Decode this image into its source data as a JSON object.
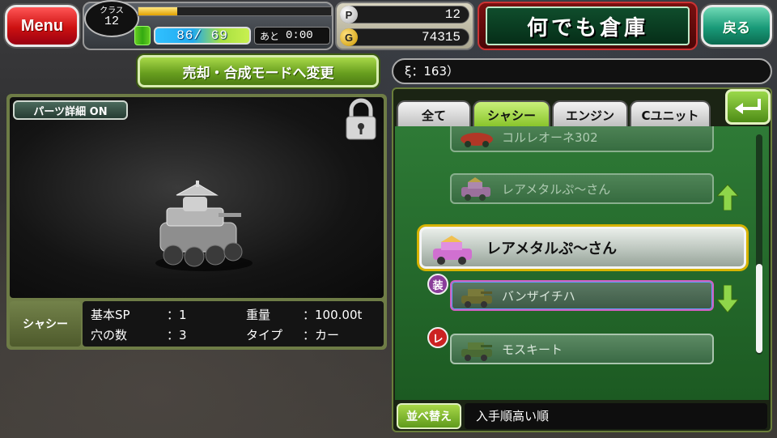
{
  "header": {
    "menu_label": "Menu",
    "class_label": "クラス",
    "class_level": "12",
    "xp_progress": 0.2,
    "stamina": "86/ 69",
    "timer_label": "あと",
    "timer_value": "0:00",
    "p_icon": "P",
    "p_value": "12",
    "g_icon": "G",
    "g_value": "74315",
    "title": "何でも倉庫",
    "back_label": "戻る"
  },
  "mode_button": "売却・合成モードへ変更",
  "item_count_text": "ξ：163）",
  "detail": {
    "parts_detail_toggle": "パーツ詳細 ON",
    "part_type": "シャシー",
    "stats": [
      {
        "label": "基本SP",
        "value": "：1"
      },
      {
        "label": "重量",
        "value": "：100.00t"
      },
      {
        "label": "穴の数",
        "value": "：3"
      },
      {
        "label": "タイプ",
        "value": "：カー"
      }
    ]
  },
  "tabs": [
    {
      "label": "全て",
      "active": false
    },
    {
      "label": "シャシー",
      "active": true
    },
    {
      "label": "エンジン",
      "active": false
    },
    {
      "label": "Cユニット",
      "active": false
    }
  ],
  "items": [
    {
      "name": "コルレオーネ302"
    },
    {
      "name": "レアメタルぷ～さん"
    },
    {
      "name": "レアメタルぷ～さん",
      "selected": true
    },
    {
      "name": "バンザイチハ",
      "badge": "装"
    },
    {
      "name": "モスキート",
      "badge": "レ"
    }
  ],
  "sort": {
    "button_label": "並べ替え",
    "value": "入手順高い順"
  },
  "colors": {
    "accent_green": "#85c226",
    "menu_red": "#c11",
    "selection_gold": "#d7b300"
  }
}
